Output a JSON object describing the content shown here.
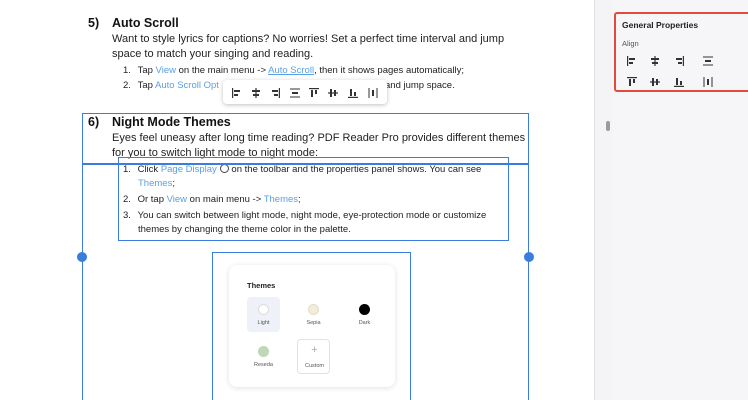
{
  "document": {
    "section5": {
      "number": "5)",
      "title": "Auto Scroll",
      "intro_line1": "Want to style lyrics for captions? No worries! Set a perfect time interval and jump",
      "intro_line2": "space to match your singing and reading.",
      "step1": {
        "num": "1.",
        "pre": "Tap ",
        "link1": "View",
        "mid": " on the main menu -> ",
        "link2": "Auto Scroll",
        "post": ", then it shows pages automatically;"
      },
      "step2": {
        "num": "2.",
        "pre": "Tap ",
        "link": "Auto Scroll Opt",
        "post": "and jump space."
      }
    },
    "section6": {
      "number": "6)",
      "title": "Night Mode Themes",
      "intro_line1": "Eyes feel uneasy after long time reading? PDF Reader Pro provides different themes",
      "intro_line2": "for you to switch light mode to night mode:",
      "step1": {
        "num": "1.",
        "pre": "Click ",
        "link": "Page Display",
        "post": " on the toolbar and the properties panel shows. You can see",
        "link2": "Themes",
        "end": ";"
      },
      "step2": {
        "num": "2.",
        "pre": "Or tap ",
        "link1": "View",
        "mid": " on main menu -> ",
        "link2": "Themes",
        "end": ";"
      },
      "step3": {
        "num": "3.",
        "line1": "You can switch between light mode, night mode, eye-protection mode or customize",
        "line2": "themes by changing the theme color in the palette."
      }
    },
    "themes_image": {
      "title": "Themes",
      "options": [
        {
          "label": "Light",
          "color": "#ffffff"
        },
        {
          "label": "Sepia",
          "color": "#f3ecd8"
        },
        {
          "label": "Dark",
          "color": "#000000"
        },
        {
          "label": "Reseda",
          "color": "#bcd8b4"
        },
        {
          "label": "Custom",
          "symbol": "+"
        }
      ]
    }
  },
  "floating_toolbar": {
    "icons": [
      "align-left-icon",
      "align-center-horizontal-icon",
      "align-right-icon",
      "distribute-horizontal-icon",
      "align-top-icon",
      "align-center-vertical-icon",
      "align-bottom-icon",
      "distribute-vertical-icon"
    ]
  },
  "properties_panel": {
    "title": "General Properties",
    "align_label": "Align",
    "icons_row1": [
      "align-left-icon",
      "align-center-horizontal-icon",
      "align-right-icon",
      "distribute-horizontal-icon"
    ],
    "icons_row2": [
      "align-top-icon",
      "align-center-vertical-icon",
      "align-bottom-icon",
      "distribute-vertical-icon"
    ]
  },
  "colors": {
    "link": "#5aa0e6",
    "selection": "#3c7be0",
    "highlight_border": "#e24b3c"
  }
}
